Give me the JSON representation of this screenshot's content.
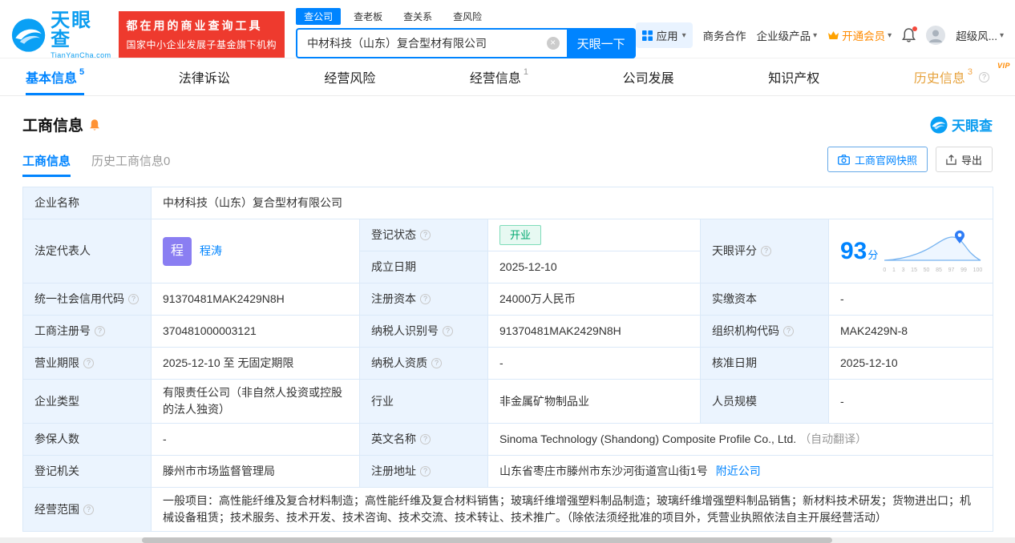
{
  "colors": {
    "brand_blue": "#0084ff",
    "logo_blue": "#0b9df0",
    "badge_red": "#ee3a2e",
    "status_green": "#00a870",
    "vip_orange": "#ff8a00",
    "avatar_purple": "#8a7ef2",
    "label_cell_bg": "#ebf4fe",
    "table_border": "#dbe9f8"
  },
  "icons": {
    "help": "?",
    "caret_down": "▾",
    "clear": "×",
    "vip_tag": "VIP"
  },
  "topbar": {
    "logo_cn": "天眼查",
    "logo_en": "TianYanCha.com",
    "badge_line1": "都在用的商业查询工具",
    "badge_line2": "国家中小企业发展子基金旗下机构",
    "search_tabs": [
      {
        "label": "查公司"
      },
      {
        "label": "查老板"
      },
      {
        "label": "查关系"
      },
      {
        "label": "查风险"
      }
    ],
    "search_value": "中材科技（山东）复合型材有限公司",
    "search_button": "天眼一下",
    "app_label": "应用",
    "link_business": "商务合作",
    "link_enterprise": "企业级产品",
    "link_vip": "开通会员",
    "user_label": "超级风..."
  },
  "nav": {
    "tabs": [
      {
        "label": "基本信息",
        "count": "5"
      },
      {
        "label": "法律诉讼",
        "count": ""
      },
      {
        "label": "经营风险",
        "count": ""
      },
      {
        "label": "经营信息",
        "count": "1"
      },
      {
        "label": "公司发展",
        "count": ""
      },
      {
        "label": "知识产权",
        "count": ""
      },
      {
        "label": "历史信息",
        "count": "3"
      }
    ]
  },
  "section": {
    "title": "工商信息",
    "brand": "天眼查"
  },
  "subtabs": {
    "current": "工商信息",
    "history": "历史工商信息0",
    "snapshot_button": "工商官网快照",
    "export_button": "导出"
  },
  "info": {
    "company_name": {
      "label": "企业名称",
      "value": "中材科技（山东）复合型材有限公司"
    },
    "legal_rep": {
      "label": "法定代表人",
      "avatar": "程",
      "name": "程涛"
    },
    "reg_status": {
      "label": "登记状态",
      "value": "开业"
    },
    "establish_date": {
      "label": "成立日期",
      "value": "2025-12-10"
    },
    "score": {
      "label": "天眼评分",
      "value": "93",
      "unit": "分",
      "ticks": [
        "0",
        "1",
        "3",
        "15",
        "50",
        "85",
        "97",
        "99",
        "100"
      ]
    },
    "credit_code": {
      "label": "统一社会信用代码",
      "value": "91370481MAK2429N8H"
    },
    "reg_capital": {
      "label": "注册资本",
      "value": "24000万人民币"
    },
    "paid_capital": {
      "label": "实缴资本",
      "value": "-"
    },
    "reg_number": {
      "label": "工商注册号",
      "value": "370481000003121"
    },
    "taxpayer_id": {
      "label": "纳税人识别号",
      "value": "91370481MAK2429N8H"
    },
    "org_code": {
      "label": "组织机构代码",
      "value": "MAK2429N-8"
    },
    "business_term": {
      "label": "营业期限",
      "value": "2025-12-10 至 无固定期限"
    },
    "taxpayer_quali": {
      "label": "纳税人资质",
      "value": "-"
    },
    "approve_date": {
      "label": "核准日期",
      "value": "2025-12-10"
    },
    "company_type": {
      "label": "企业类型",
      "value": "有限责任公司（非自然人投资或控股的法人独资）"
    },
    "industry": {
      "label": "行业",
      "value": "非金属矿物制品业"
    },
    "staff_size": {
      "label": "人员规模",
      "value": "-"
    },
    "insured_num": {
      "label": "参保人数",
      "value": "-"
    },
    "english_name": {
      "label": "英文名称",
      "value": "Sinoma Technology (Shandong) Composite Profile Co., Ltd.",
      "note": "（自动翻译）"
    },
    "reg_authority": {
      "label": "登记机关",
      "value": "滕州市市场监督管理局"
    },
    "reg_address": {
      "label": "注册地址",
      "value": "山东省枣庄市滕州市东沙河街道宫山街1号",
      "link": "附近公司"
    },
    "business_scope": {
      "label": "经营范围",
      "value": "一般项目：高性能纤维及复合材料制造；高性能纤维及复合材料销售；玻璃纤维增强塑料制品制造；玻璃纤维增强塑料制品销售；新材料技术研发；货物进出口；机械设备租赁；技术服务、技术开发、技术咨询、技术交流、技术转让、技术推广。（除依法须经批准的项目外，凭营业执照依法自主开展经营活动）"
    }
  }
}
